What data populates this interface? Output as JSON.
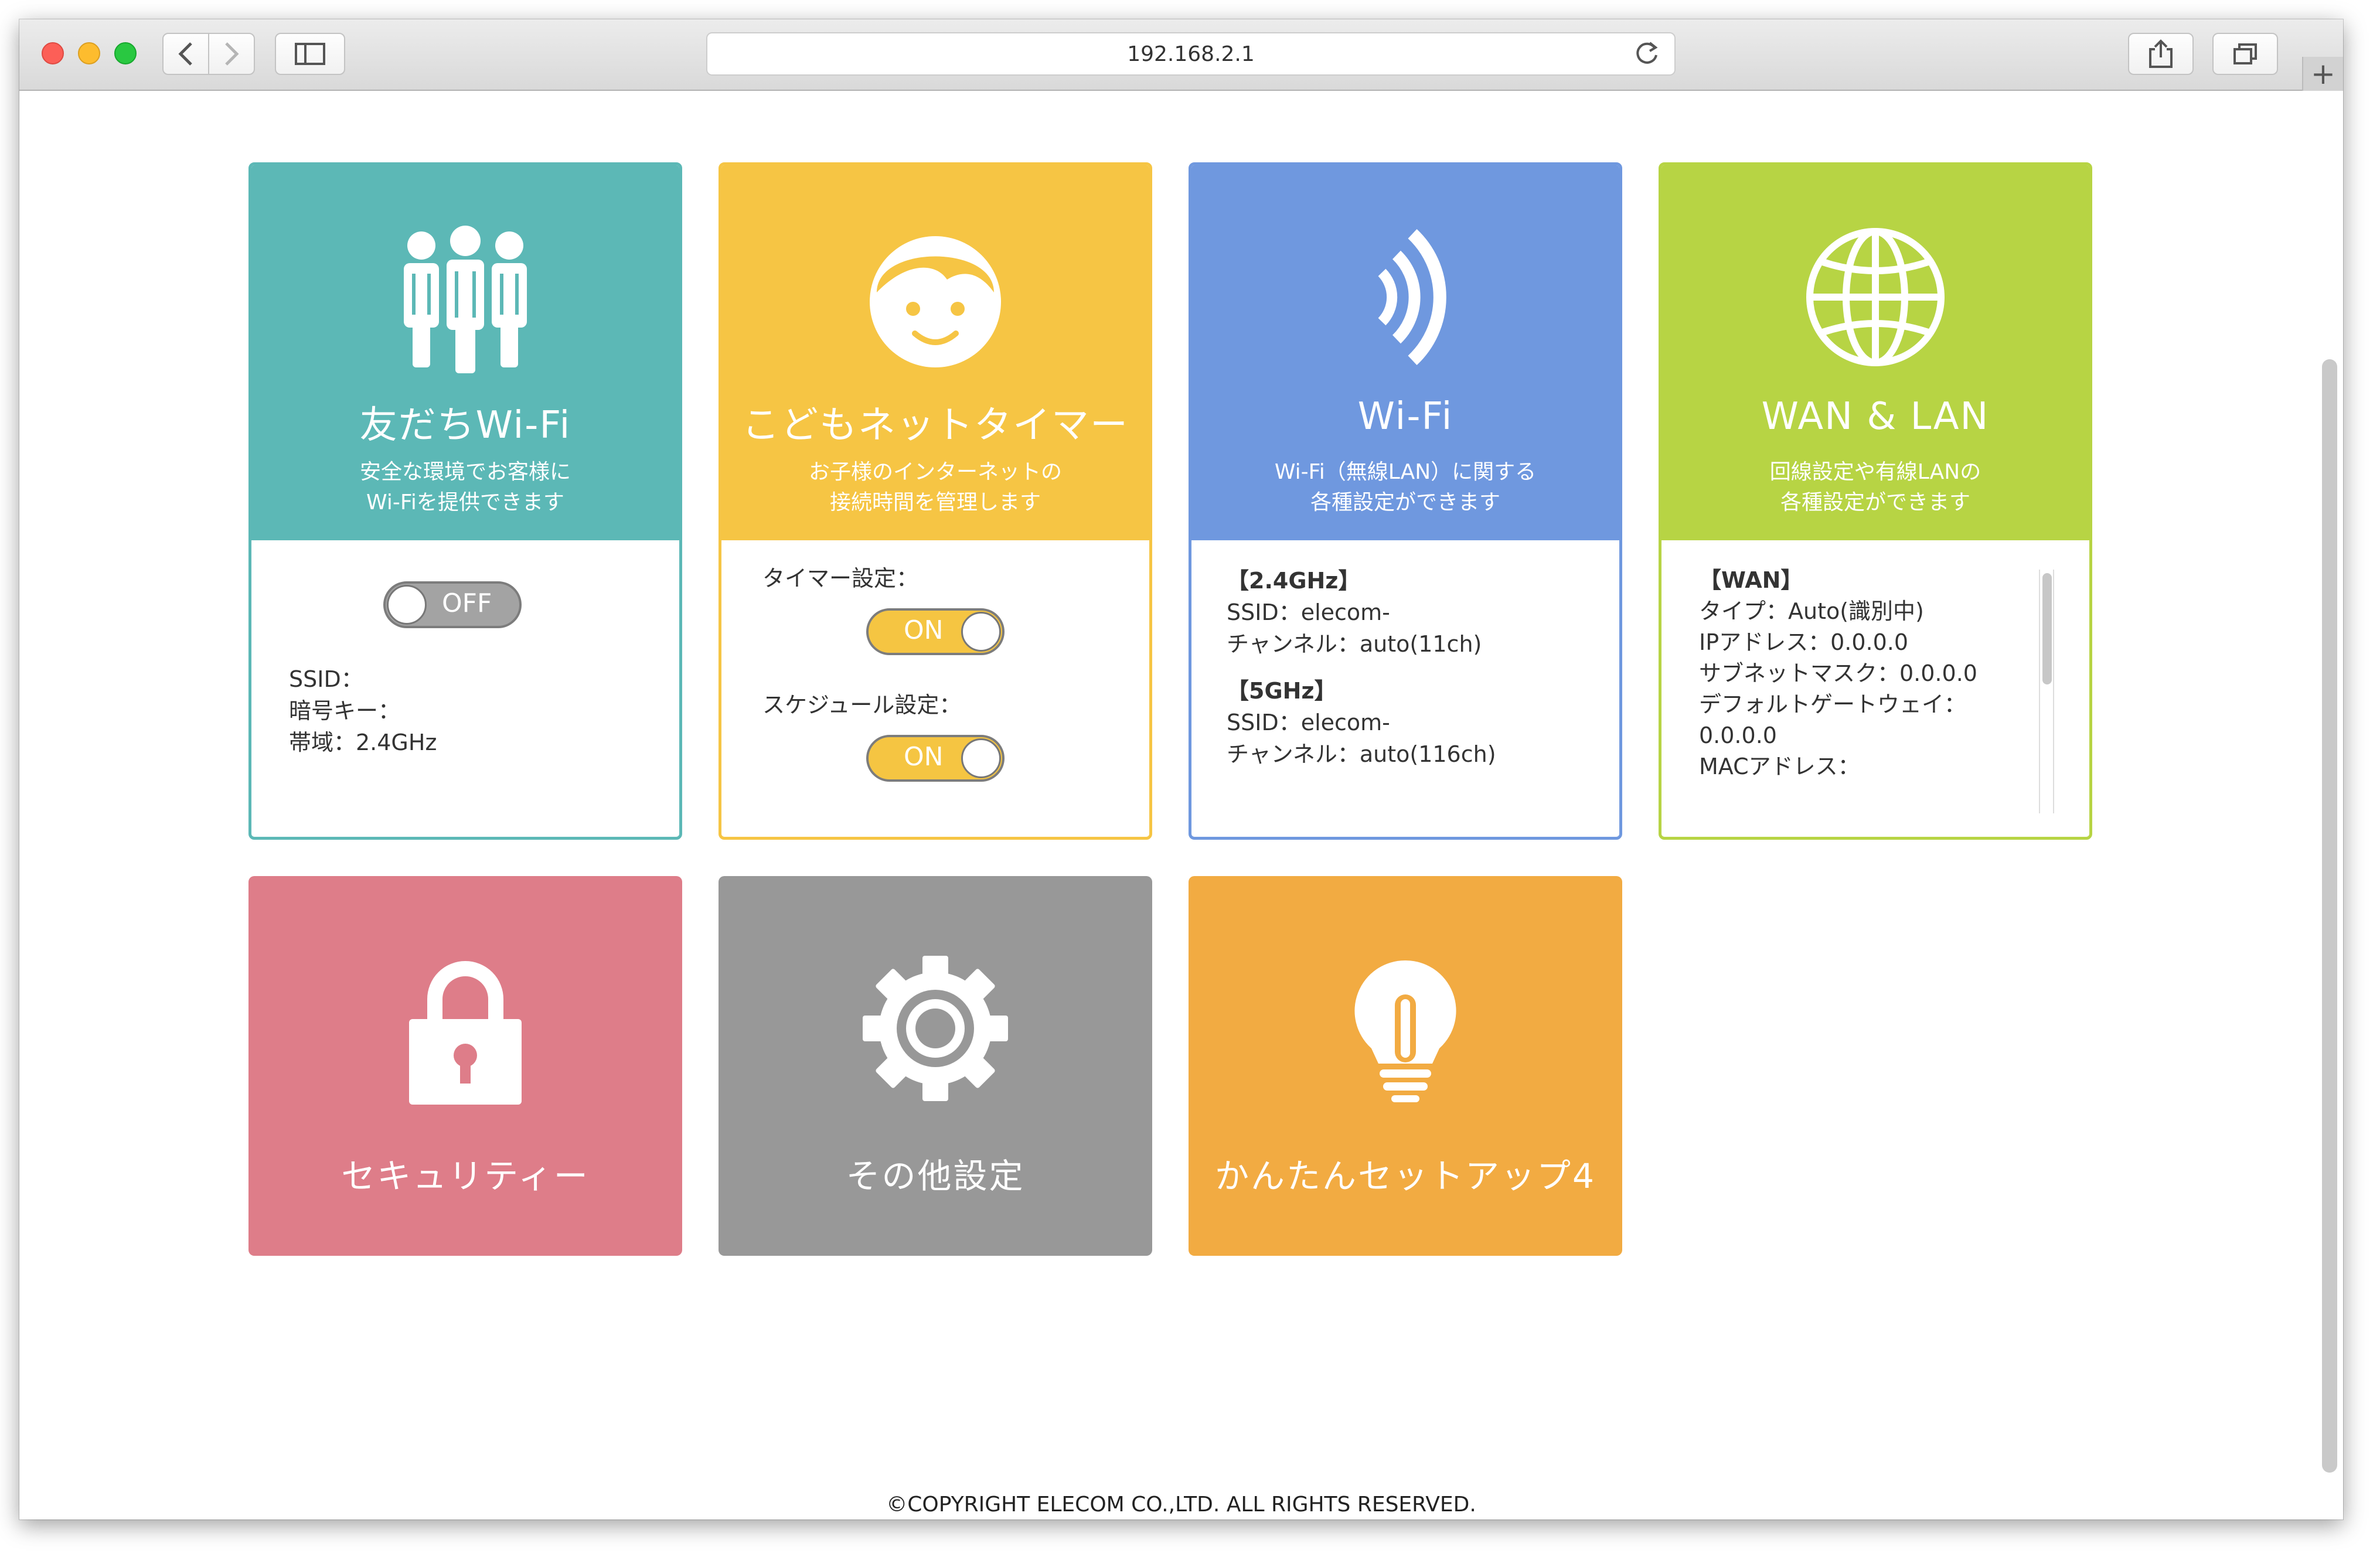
{
  "browser": {
    "address": "192.168.2.1",
    "new_tab_label": "+"
  },
  "tiles": {
    "tomodachi": {
      "title": "友だちWi-Fi",
      "desc_line1": "安全な環境でお客様に",
      "desc_line2": "Wi-Fiを提供できます",
      "toggle": "OFF",
      "info": [
        "SSID：",
        "暗号キー：",
        "帯域：2.4GHz"
      ],
      "color": "#5cb8b6"
    },
    "kodomo": {
      "title": "こどもネットタイマー",
      "desc_line1": "お子様のインターネットの",
      "desc_line2": "接続時間を管理します",
      "timer_label": "タイマー設定：",
      "timer_toggle": "ON",
      "schedule_label": "スケジュール設定：",
      "schedule_toggle": "ON",
      "color": "#f6c544"
    },
    "wifi": {
      "title": "Wi-Fi",
      "desc_line1": "Wi-Fi（無線LAN）に関する",
      "desc_line2": "各種設定ができます",
      "band1_header": "【2.4GHz】",
      "band1_ssid": "SSID：elecom-",
      "band1_channel": "チャンネル：auto(11ch)",
      "band2_header": "【5GHz】",
      "band2_ssid": "SSID：elecom-",
      "band2_channel": "チャンネル：auto(116ch)",
      "color": "#6f98df"
    },
    "wanlan": {
      "title": "WAN & LAN",
      "desc_line1": "回線設定や有線LANの",
      "desc_line2": "各種設定ができます",
      "wan_header": "【WAN】",
      "type": "タイプ：Auto(識別中)",
      "ip": "IPアドレス：0.0.0.0",
      "subnet": "サブネットマスク：0.0.0.0",
      "gateway_label": "デフォルトゲートウェイ：",
      "gateway_value": "0.0.0.0",
      "mac": "MACアドレス：",
      "color": "#b7d444"
    },
    "security": {
      "title": "セキュリティー",
      "color": "#de7d89"
    },
    "other": {
      "title": "その他設定",
      "color": "#989898"
    },
    "setup": {
      "title": "かんたんセットアップ4",
      "color": "#f2ab42"
    }
  },
  "footer": "©COPYRIGHT ELECOM CO.,LTD. ALL RIGHTS RESERVED."
}
